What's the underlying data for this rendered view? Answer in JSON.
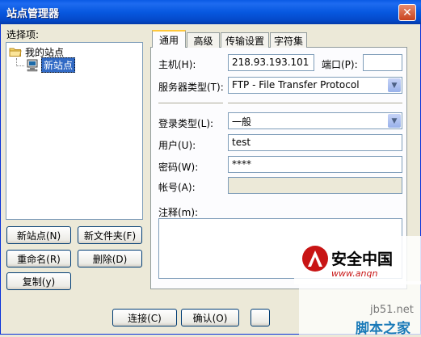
{
  "window": {
    "title": "站点管理器",
    "close_glyph": "✕"
  },
  "sidebar": {
    "label": "选择项:",
    "tree": [
      {
        "label": "我的站点",
        "icon": "folder-icon"
      },
      {
        "label": "新站点",
        "icon": "computer-icon"
      }
    ],
    "buttons": {
      "new_site": "新站点(N)",
      "new_folder": "新文件夹(F)",
      "rename": "重命名(R)",
      "delete": "删除(D)",
      "copy": "复制(y)"
    }
  },
  "tabs": [
    {
      "label": "通用",
      "selected": true
    },
    {
      "label": "高级",
      "selected": false
    },
    {
      "label": "传输设置",
      "selected": false
    },
    {
      "label": "字符集",
      "selected": false
    }
  ],
  "form": {
    "host_label": "主机(H):",
    "host_value": "218.93.193.101",
    "port_label": "端口(P):",
    "port_value": "",
    "server_type_label": "服务器类型(T):",
    "server_type_value": "FTP - File Transfer Protocol",
    "logon_type_label": "登录类型(L):",
    "logon_type_value": "一般",
    "user_label": "用户(U):",
    "user_value": "test",
    "password_label": "密码(W):",
    "password_value": "****",
    "account_label": "帐号(A):",
    "account_value": "",
    "comments_label": "注释(m):",
    "comments_value": ""
  },
  "footer": {
    "connect": "连接(C)",
    "ok": "确认(O)"
  },
  "watermarks": {
    "anquan": "安全中国",
    "anquan_url": "www.anqn",
    "jb51": "jb51.net",
    "jiaoben": "脚本之家"
  },
  "colors": {
    "accent": "#0A5BE5",
    "tab_highlight": "#FFC83C",
    "close": "#C8421F"
  }
}
